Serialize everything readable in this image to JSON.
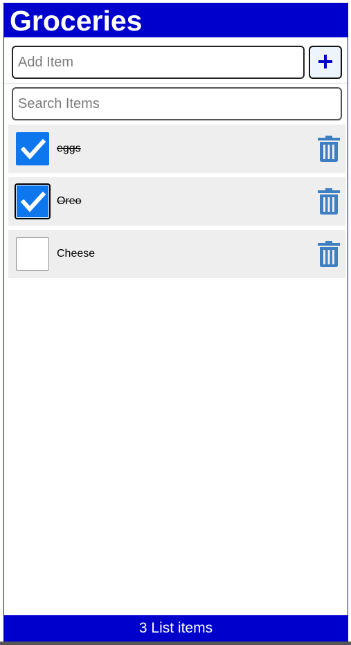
{
  "header": {
    "title": "Groceries"
  },
  "add_form": {
    "placeholder": "Add Item",
    "add_icon": "plus-icon"
  },
  "search_form": {
    "placeholder": "Search Items"
  },
  "items": [
    {
      "label": "eggs",
      "checked": true,
      "focused": false
    },
    {
      "label": "Oreo",
      "checked": true,
      "focused": true
    },
    {
      "label": "Cheese",
      "checked": false,
      "focused": false
    }
  ],
  "footer": {
    "count_text": "3 List items"
  },
  "colors": {
    "brand": "#0000cc",
    "checkbox_checked": "#0f77ee",
    "trash_icon": "#3e7fc1",
    "row_background": "#eeeeee"
  }
}
